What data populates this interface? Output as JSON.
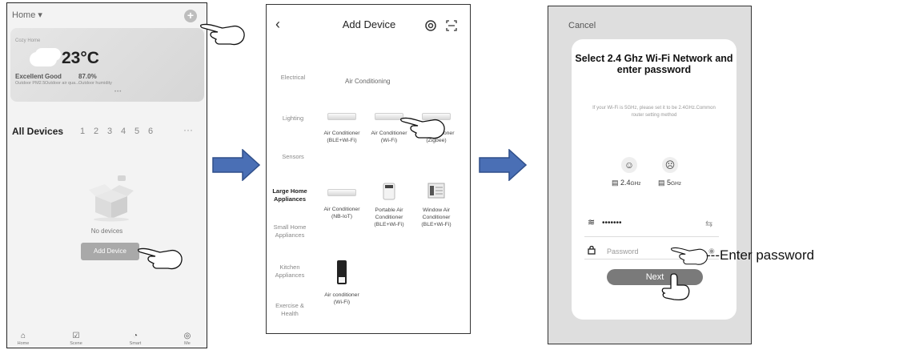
{
  "screen1": {
    "home_label": "Home ▾",
    "home_name": "Cozy Home",
    "temperature": "23°C",
    "weather_stats": [
      {
        "value": "Excellent",
        "label": "Outdoor PM2.5"
      },
      {
        "value": "Good",
        "label": "Outdoor air qua..."
      },
      {
        "value": "87.0%",
        "label": "Outdoor humidity"
      }
    ],
    "tabs": [
      "All Devices",
      "1",
      "2",
      "3",
      "4",
      "5",
      "6"
    ],
    "more": "···",
    "empty_text": "No devices",
    "add_button": "Add Device",
    "bottom_nav": [
      {
        "label": "Home",
        "icon": "home-icon"
      },
      {
        "label": "Scene",
        "icon": "scene-icon"
      },
      {
        "label": "Smart",
        "icon": "smart-icon"
      },
      {
        "label": "Me",
        "icon": "me-icon"
      }
    ]
  },
  "screen2": {
    "title": "Add Device",
    "categories": [
      "Electrical",
      "Lighting",
      "Sensors",
      "Large Home Appliances",
      "Small Home Appliances",
      "Kitchen Appliances",
      "Exercise & Health"
    ],
    "selected_category": "Large Home Appliances",
    "section_header": "Air Conditioning",
    "devices": [
      "Air Conditioner (BLE+Wi-Fi)",
      "Air Conditioner (Wi-Fi)",
      "Air Conditioner (Zigbee)",
      "Air Conditioner (NB-IoT)",
      "Portable Air Conditioner (BLE+Wi-Fi)",
      "Window Air Conditioner (BLE+Wi-Fi)",
      "Air conditioner (Wi-Fi)"
    ]
  },
  "screen3": {
    "cancel": "Cancel",
    "heading": "Select 2.4 Ghz Wi-Fi Network and enter password",
    "tip": "If your Wi-Fi is 5GHz, please set it to be 2.4GHz.Common router setting method",
    "band_24": "2.4",
    "band_5": "5",
    "band_unit": "GHz",
    "ssid": "•••••••",
    "password_placeholder": "Password",
    "next_button": "Next"
  },
  "annotation": "---Enter password",
  "colors": {
    "arrow_fill": "#4a6fb5",
    "arrow_stroke": "#2f4f8a"
  }
}
